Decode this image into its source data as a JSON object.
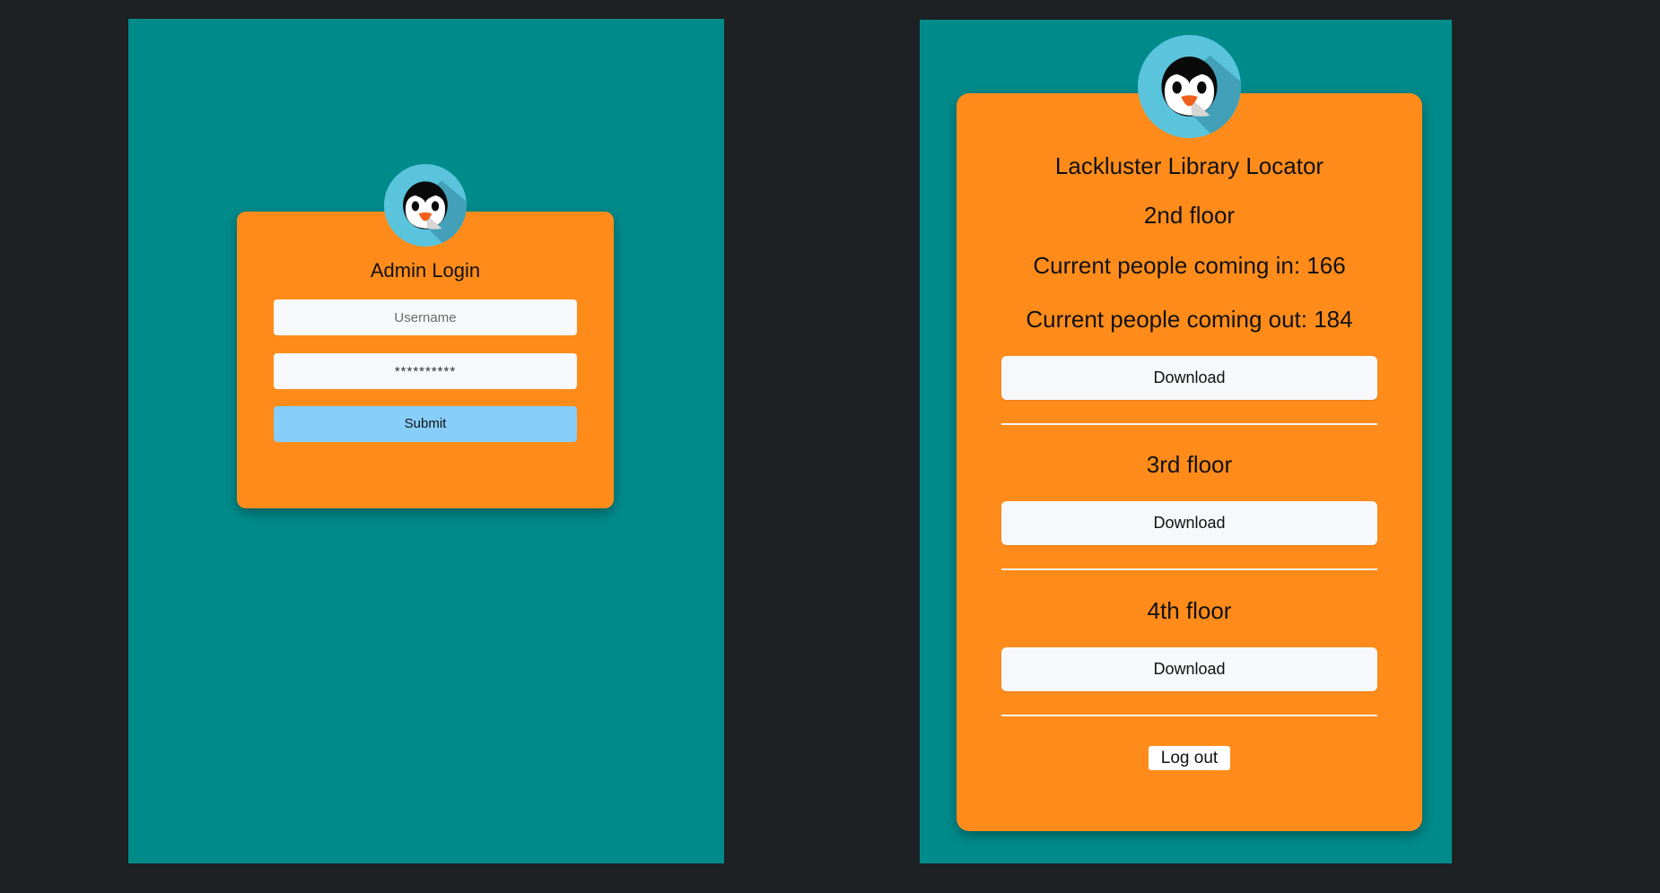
{
  "login": {
    "title": "Admin Login",
    "username_placeholder": "Username",
    "password_placeholder": "**********",
    "submit_label": "Submit"
  },
  "locator": {
    "title": "Lackluster Library Locator",
    "floors": [
      {
        "name": "2nd floor",
        "people_in": "Current people coming in: 166",
        "people_out": "Current people coming out: 184",
        "download_label": "Download"
      },
      {
        "name": "3rd floor",
        "download_label": "Download"
      },
      {
        "name": "4th floor",
        "download_label": "Download"
      }
    ],
    "logout_label": "Log out"
  },
  "icons": {
    "avatar": "penguin-icon"
  },
  "colors": {
    "background": "#1e2124",
    "panel": "#008b8b",
    "card": "#ff8c1a",
    "submit": "#87cefa",
    "avatar": "#5bc4dd"
  }
}
